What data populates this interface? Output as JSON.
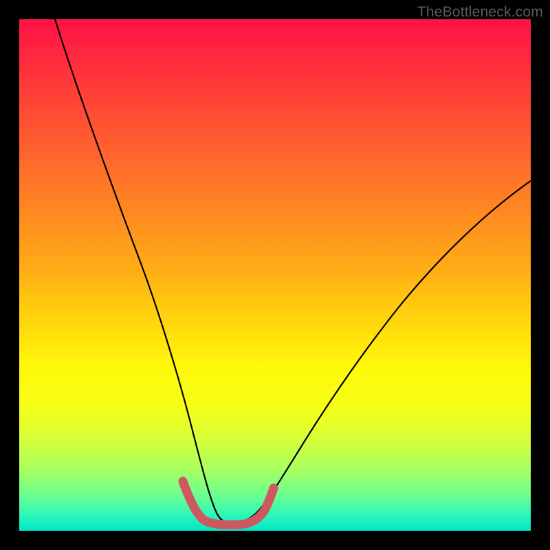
{
  "watermark": "TheBottleneck.com",
  "chart_data": {
    "type": "line",
    "title": "",
    "xlabel": "",
    "ylabel": "",
    "xlim": [
      0,
      100
    ],
    "ylim": [
      0,
      100
    ],
    "series": [
      {
        "name": "bottleneck-curve",
        "x": [
          7,
          12,
          18,
          23,
          27,
          30,
          32,
          34,
          35.5,
          37,
          38.5,
          40,
          42,
          44,
          47,
          50,
          55,
          62,
          72,
          82,
          92,
          100
        ],
        "y": [
          100,
          86,
          70,
          56,
          44,
          33,
          25,
          18,
          12,
          7,
          4,
          2.5,
          2.5,
          3,
          5,
          9,
          16,
          25,
          38,
          50,
          59,
          65
        ]
      },
      {
        "name": "target-marker",
        "x": [
          32.5,
          34,
          36,
          37.5,
          39,
          41,
          43,
          45,
          47,
          48.5
        ],
        "y": [
          8.5,
          5.5,
          3.2,
          2.6,
          2.6,
          2.6,
          2.6,
          3.3,
          5.4,
          8.3
        ]
      }
    ],
    "colors": {
      "curve": "#000000",
      "marker": "#cf5760",
      "gradient_top": "#ff1245",
      "gradient_bottom": "#00e6c8"
    }
  }
}
